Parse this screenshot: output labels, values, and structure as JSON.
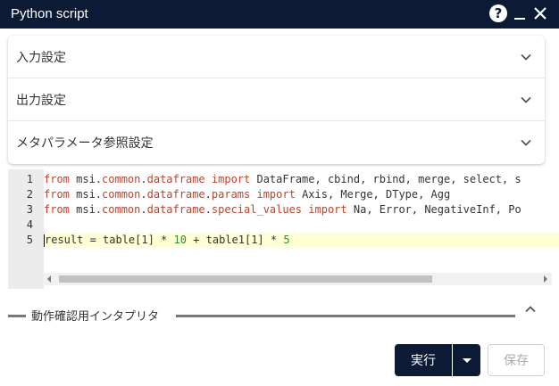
{
  "window": {
    "title": "Python script"
  },
  "accordion": {
    "items": [
      {
        "label": "入力設定"
      },
      {
        "label": "出力設定"
      },
      {
        "label": "メタパラメータ参照設定"
      }
    ]
  },
  "editor": {
    "line_numbers": [
      "1",
      "2",
      "3",
      "4",
      "5"
    ],
    "lines": [
      {
        "tokens": [
          {
            "t": "from",
            "c": "kw"
          },
          {
            "t": " msi.",
            "c": ""
          },
          {
            "t": "common",
            "c": "mod"
          },
          {
            "t": ".",
            "c": ""
          },
          {
            "t": "dataframe",
            "c": "mod"
          },
          {
            "t": " ",
            "c": ""
          },
          {
            "t": "import",
            "c": "kw"
          },
          {
            "t": " DataFrame, cbind, rbind, merge, select, s",
            "c": ""
          }
        ]
      },
      {
        "tokens": [
          {
            "t": "from",
            "c": "kw"
          },
          {
            "t": " msi.",
            "c": ""
          },
          {
            "t": "common",
            "c": "mod"
          },
          {
            "t": ".",
            "c": ""
          },
          {
            "t": "dataframe",
            "c": "mod"
          },
          {
            "t": ".",
            "c": ""
          },
          {
            "t": "params",
            "c": "mod"
          },
          {
            "t": " ",
            "c": ""
          },
          {
            "t": "import",
            "c": "kw"
          },
          {
            "t": " Axis, Merge, DType, Agg",
            "c": ""
          }
        ]
      },
      {
        "tokens": [
          {
            "t": "from",
            "c": "kw"
          },
          {
            "t": " msi.",
            "c": ""
          },
          {
            "t": "common",
            "c": "mod"
          },
          {
            "t": ".",
            "c": ""
          },
          {
            "t": "dataframe",
            "c": "mod"
          },
          {
            "t": ".",
            "c": ""
          },
          {
            "t": "special_values",
            "c": "mod"
          },
          {
            "t": " ",
            "c": ""
          },
          {
            "t": "import",
            "c": "kw"
          },
          {
            "t": " Na, Error, NegativeInf, Po",
            "c": ""
          }
        ]
      },
      {
        "tokens": []
      },
      {
        "tokens": [
          {
            "t": "result = table[1] * ",
            "c": ""
          },
          {
            "t": "10",
            "c": "num"
          },
          {
            "t": " + table1[1] * ",
            "c": ""
          },
          {
            "t": "5",
            "c": "num"
          }
        ]
      }
    ],
    "active_line": 5
  },
  "section": {
    "label": "動作確認用インタプリタ"
  },
  "buttons": {
    "run_label": "実行",
    "save_label": "保存"
  },
  "colors": {
    "titlebar_bg": "#0c1a35",
    "keyword": "#b5452f",
    "number": "#2e8b2e",
    "active_line_bg": "#ffffd6"
  }
}
